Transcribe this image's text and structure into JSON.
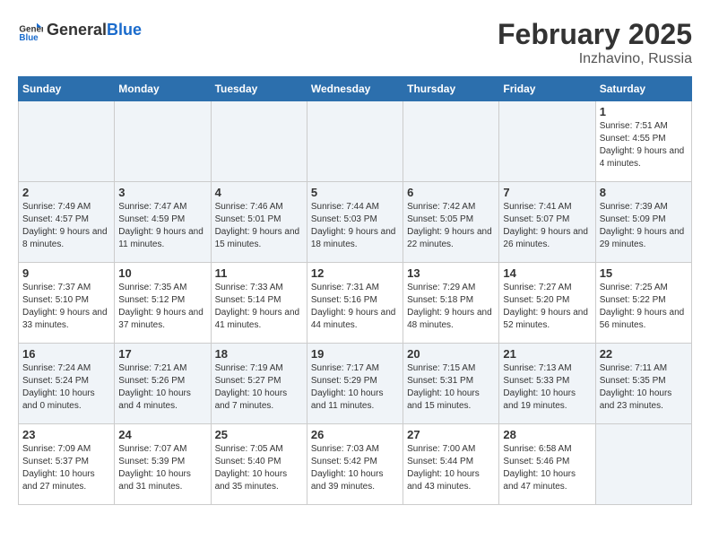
{
  "header": {
    "logo_general": "General",
    "logo_blue": "Blue",
    "title": "February 2025",
    "subtitle": "Inzhavino, Russia"
  },
  "days_of_week": [
    "Sunday",
    "Monday",
    "Tuesday",
    "Wednesday",
    "Thursday",
    "Friday",
    "Saturday"
  ],
  "weeks": [
    [
      {
        "day": "",
        "empty": true
      },
      {
        "day": "",
        "empty": true
      },
      {
        "day": "",
        "empty": true
      },
      {
        "day": "",
        "empty": true
      },
      {
        "day": "",
        "empty": true
      },
      {
        "day": "",
        "empty": true
      },
      {
        "day": "1",
        "sunrise": "Sunrise: 7:51 AM",
        "sunset": "Sunset: 4:55 PM",
        "daylight": "Daylight: 9 hours and 4 minutes."
      }
    ],
    [
      {
        "day": "2",
        "sunrise": "Sunrise: 7:49 AM",
        "sunset": "Sunset: 4:57 PM",
        "daylight": "Daylight: 9 hours and 8 minutes."
      },
      {
        "day": "3",
        "sunrise": "Sunrise: 7:47 AM",
        "sunset": "Sunset: 4:59 PM",
        "daylight": "Daylight: 9 hours and 11 minutes."
      },
      {
        "day": "4",
        "sunrise": "Sunrise: 7:46 AM",
        "sunset": "Sunset: 5:01 PM",
        "daylight": "Daylight: 9 hours and 15 minutes."
      },
      {
        "day": "5",
        "sunrise": "Sunrise: 7:44 AM",
        "sunset": "Sunset: 5:03 PM",
        "daylight": "Daylight: 9 hours and 18 minutes."
      },
      {
        "day": "6",
        "sunrise": "Sunrise: 7:42 AM",
        "sunset": "Sunset: 5:05 PM",
        "daylight": "Daylight: 9 hours and 22 minutes."
      },
      {
        "day": "7",
        "sunrise": "Sunrise: 7:41 AM",
        "sunset": "Sunset: 5:07 PM",
        "daylight": "Daylight: 9 hours and 26 minutes."
      },
      {
        "day": "8",
        "sunrise": "Sunrise: 7:39 AM",
        "sunset": "Sunset: 5:09 PM",
        "daylight": "Daylight: 9 hours and 29 minutes."
      }
    ],
    [
      {
        "day": "9",
        "sunrise": "Sunrise: 7:37 AM",
        "sunset": "Sunset: 5:10 PM",
        "daylight": "Daylight: 9 hours and 33 minutes."
      },
      {
        "day": "10",
        "sunrise": "Sunrise: 7:35 AM",
        "sunset": "Sunset: 5:12 PM",
        "daylight": "Daylight: 9 hours and 37 minutes."
      },
      {
        "day": "11",
        "sunrise": "Sunrise: 7:33 AM",
        "sunset": "Sunset: 5:14 PM",
        "daylight": "Daylight: 9 hours and 41 minutes."
      },
      {
        "day": "12",
        "sunrise": "Sunrise: 7:31 AM",
        "sunset": "Sunset: 5:16 PM",
        "daylight": "Daylight: 9 hours and 44 minutes."
      },
      {
        "day": "13",
        "sunrise": "Sunrise: 7:29 AM",
        "sunset": "Sunset: 5:18 PM",
        "daylight": "Daylight: 9 hours and 48 minutes."
      },
      {
        "day": "14",
        "sunrise": "Sunrise: 7:27 AM",
        "sunset": "Sunset: 5:20 PM",
        "daylight": "Daylight: 9 hours and 52 minutes."
      },
      {
        "day": "15",
        "sunrise": "Sunrise: 7:25 AM",
        "sunset": "Sunset: 5:22 PM",
        "daylight": "Daylight: 9 hours and 56 minutes."
      }
    ],
    [
      {
        "day": "16",
        "sunrise": "Sunrise: 7:24 AM",
        "sunset": "Sunset: 5:24 PM",
        "daylight": "Daylight: 10 hours and 0 minutes."
      },
      {
        "day": "17",
        "sunrise": "Sunrise: 7:21 AM",
        "sunset": "Sunset: 5:26 PM",
        "daylight": "Daylight: 10 hours and 4 minutes."
      },
      {
        "day": "18",
        "sunrise": "Sunrise: 7:19 AM",
        "sunset": "Sunset: 5:27 PM",
        "daylight": "Daylight: 10 hours and 7 minutes."
      },
      {
        "day": "19",
        "sunrise": "Sunrise: 7:17 AM",
        "sunset": "Sunset: 5:29 PM",
        "daylight": "Daylight: 10 hours and 11 minutes."
      },
      {
        "day": "20",
        "sunrise": "Sunrise: 7:15 AM",
        "sunset": "Sunset: 5:31 PM",
        "daylight": "Daylight: 10 hours and 15 minutes."
      },
      {
        "day": "21",
        "sunrise": "Sunrise: 7:13 AM",
        "sunset": "Sunset: 5:33 PM",
        "daylight": "Daylight: 10 hours and 19 minutes."
      },
      {
        "day": "22",
        "sunrise": "Sunrise: 7:11 AM",
        "sunset": "Sunset: 5:35 PM",
        "daylight": "Daylight: 10 hours and 23 minutes."
      }
    ],
    [
      {
        "day": "23",
        "sunrise": "Sunrise: 7:09 AM",
        "sunset": "Sunset: 5:37 PM",
        "daylight": "Daylight: 10 hours and 27 minutes."
      },
      {
        "day": "24",
        "sunrise": "Sunrise: 7:07 AM",
        "sunset": "Sunset: 5:39 PM",
        "daylight": "Daylight: 10 hours and 31 minutes."
      },
      {
        "day": "25",
        "sunrise": "Sunrise: 7:05 AM",
        "sunset": "Sunset: 5:40 PM",
        "daylight": "Daylight: 10 hours and 35 minutes."
      },
      {
        "day": "26",
        "sunrise": "Sunrise: 7:03 AM",
        "sunset": "Sunset: 5:42 PM",
        "daylight": "Daylight: 10 hours and 39 minutes."
      },
      {
        "day": "27",
        "sunrise": "Sunrise: 7:00 AM",
        "sunset": "Sunset: 5:44 PM",
        "daylight": "Daylight: 10 hours and 43 minutes."
      },
      {
        "day": "28",
        "sunrise": "Sunrise: 6:58 AM",
        "sunset": "Sunset: 5:46 PM",
        "daylight": "Daylight: 10 hours and 47 minutes."
      },
      {
        "day": "",
        "empty": true
      }
    ]
  ]
}
